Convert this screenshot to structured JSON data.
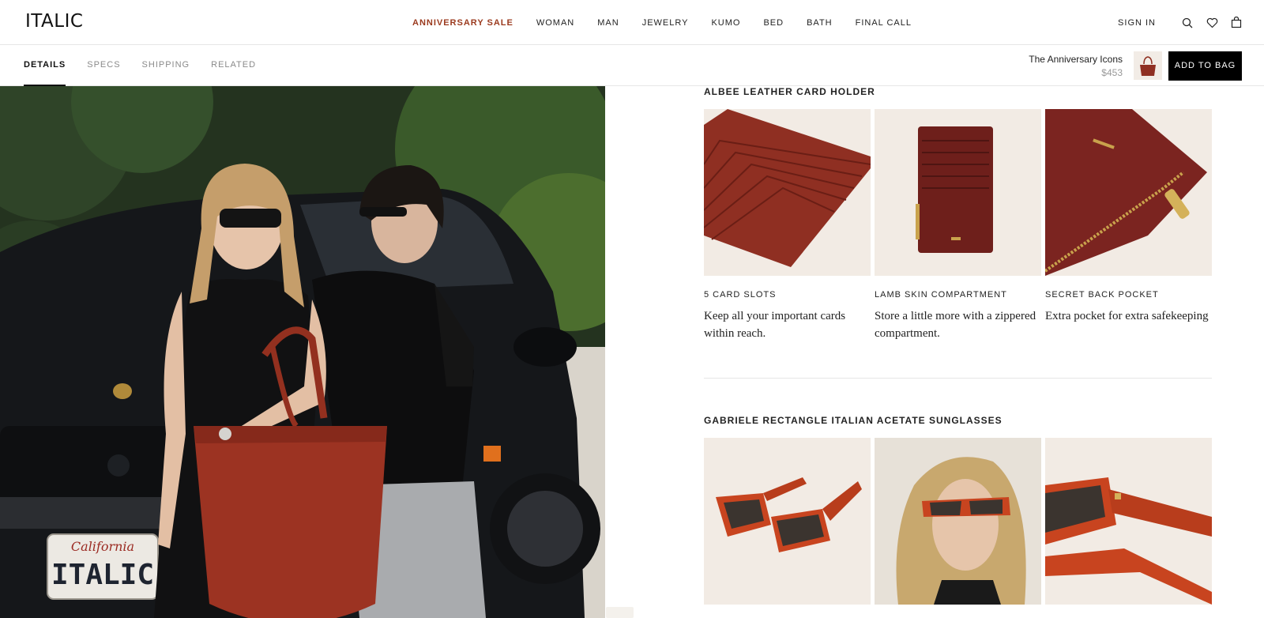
{
  "brand": {
    "logo": "ITALIC"
  },
  "nav": {
    "items": [
      "ANNIVERSARY SALE",
      "WOMAN",
      "MAN",
      "JEWELRY",
      "KUMO",
      "BED",
      "BATH",
      "FINAL CALL"
    ],
    "sign_in": "SIGN IN",
    "icons": [
      "search-icon",
      "heart-icon",
      "bag-icon"
    ]
  },
  "subnav": {
    "tabs": [
      "DETAILS",
      "SPECS",
      "SHIPPING",
      "RELATED"
    ],
    "active": "DETAILS"
  },
  "sticky_product": {
    "name": "The Anniversary Icons",
    "price": "$453",
    "add_label": "ADD TO BAG"
  },
  "hero": {
    "plate_state": "California",
    "plate_text": "ITALIC"
  },
  "sections": [
    {
      "title": "ALBEE LEATHER CARD HOLDER",
      "features": [
        {
          "title": "5 CARD SLOTS",
          "desc": "Keep all your important cards within reach."
        },
        {
          "title": "LAMB SKIN COMPARTMENT",
          "desc": "Store a little more with a zippered compartment."
        },
        {
          "title": "SECRET BACK POCKET",
          "desc": "Extra pocket for extra safekeeping"
        }
      ]
    },
    {
      "title": "GABRIELE RECTANGLE ITALIAN ACETATE SUNGLASSES"
    }
  ],
  "colors": {
    "sale": "#9b3a1e",
    "leather": "#8f2f22",
    "sunglass": "#c8441f",
    "card_bg": "#f2ebe4"
  }
}
